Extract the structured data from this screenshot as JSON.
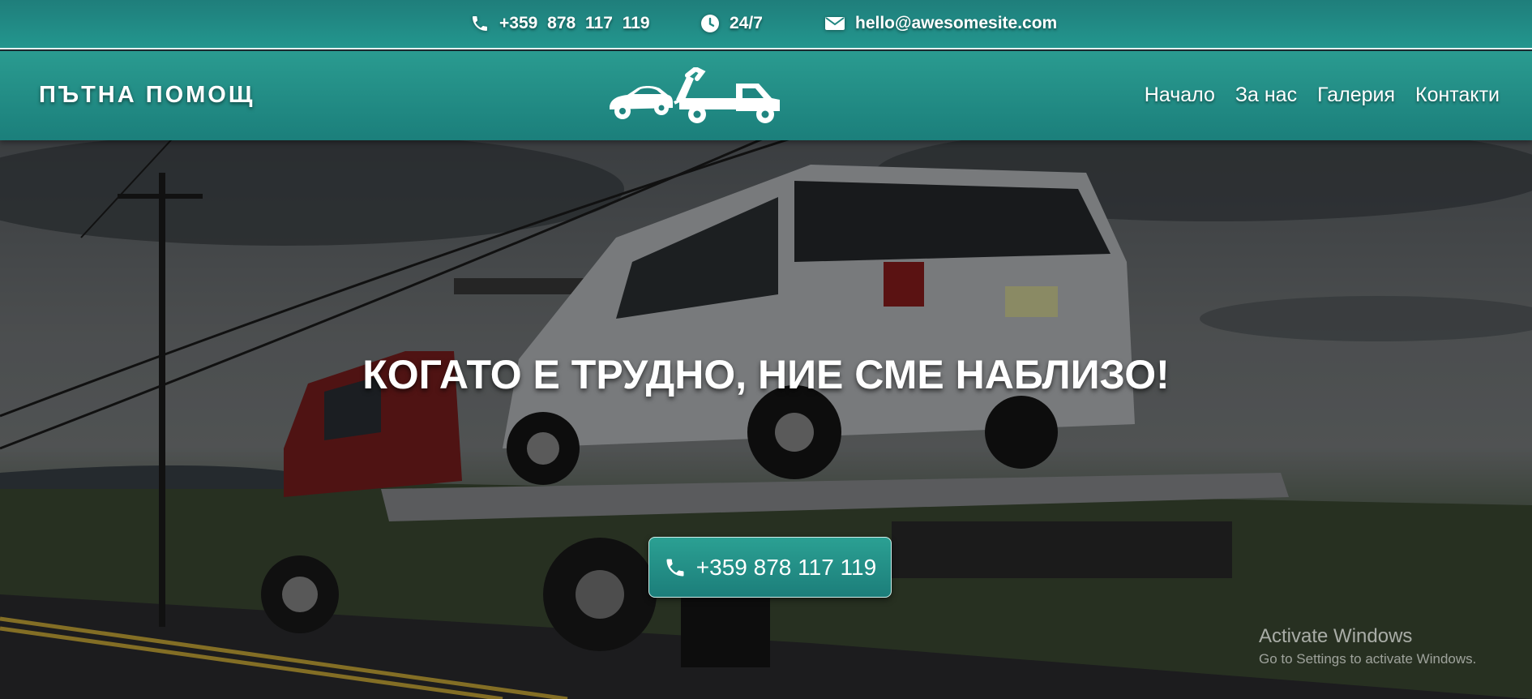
{
  "topbar": {
    "phone": "+359  878  117  119",
    "hours": "24/7",
    "email": "hello@awesomesite.com"
  },
  "header": {
    "brand": "ПЪТНА ПОМОЩ",
    "nav": [
      "Начало",
      "За нас",
      "Галерия",
      "Контакти"
    ]
  },
  "hero": {
    "headline": "КОГАТО Е ТРУДНО, НИЕ СМЕ НАБЛИЗО!",
    "cta_phone": "+359 878 117 119"
  },
  "overlay": {
    "activate_title": "Activate Windows",
    "activate_sub": "Go to Settings to activate Windows."
  },
  "colors": {
    "accent": "#23968e",
    "accent_dark": "#1b7f7b"
  }
}
